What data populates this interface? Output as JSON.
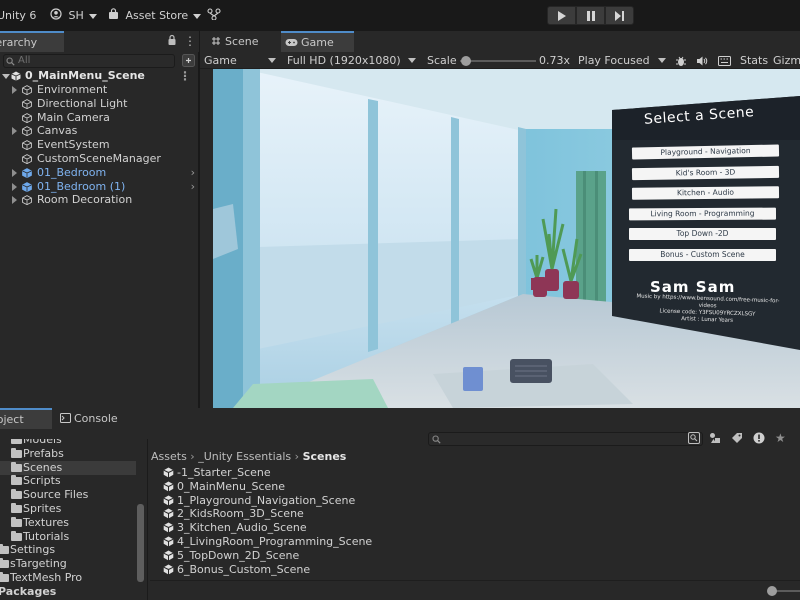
{
  "toolbar": {
    "app_name": "Unity 6",
    "account": "SH",
    "asset_store": "Asset Store",
    "play_icons": [
      "play-icon",
      "pause-icon",
      "step-icon"
    ]
  },
  "hierarchy": {
    "tab_label": "Hierarchy",
    "search_placeholder": "All",
    "scene_name": "0_MainMenu_Scene",
    "items": [
      {
        "label": "Environment",
        "kind": "object",
        "expandable": true
      },
      {
        "label": "Directional Light",
        "kind": "object",
        "expandable": false
      },
      {
        "label": "Main Camera",
        "kind": "object",
        "expandable": false
      },
      {
        "label": "Canvas",
        "kind": "object",
        "expandable": true
      },
      {
        "label": "EventSystem",
        "kind": "object",
        "expandable": false
      },
      {
        "label": "CustomSceneManager",
        "kind": "object",
        "expandable": false
      },
      {
        "label": "01_Bedroom",
        "kind": "prefab",
        "expandable": true
      },
      {
        "label": "01_Bedroom (1)",
        "kind": "prefab",
        "expandable": true
      },
      {
        "label": "Room Decoration",
        "kind": "object",
        "expandable": true
      }
    ]
  },
  "view_tabs": {
    "scene": "Scene",
    "game": "Game"
  },
  "game_controls": {
    "display": "Game",
    "resolution": "Full HD (1920x1080)",
    "scale_label": "Scale",
    "scale_value": "0.73x",
    "scale_fraction": 0.05,
    "play_mode": "Play Focused",
    "stats": "Stats",
    "gizmos": "Gizmos"
  },
  "menu": {
    "title": "Select a Scene",
    "buttons": [
      "Playground - Navigation",
      "Kid's Room - 3D",
      "Kitchen - Audio",
      "Living Room - Programming",
      "Top Down -2D",
      "Bonus - Custom Scene"
    ],
    "name": "Sam Sam",
    "credits": [
      "Music by https://www.bensound.com/free-music-for-",
      "videos",
      "License code: Y3FSU09YRCZXLSGY",
      "Artist : Lunar Years"
    ]
  },
  "project": {
    "tab_label": "Project",
    "console_label": "Console",
    "folders": [
      {
        "label": "Models",
        "selected": false,
        "indent": 1
      },
      {
        "label": "Prefabs",
        "selected": false,
        "indent": 1
      },
      {
        "label": "Scenes",
        "selected": true,
        "indent": 1
      },
      {
        "label": "Scripts",
        "selected": false,
        "indent": 1
      },
      {
        "label": "Source Files",
        "selected": false,
        "indent": 1
      },
      {
        "label": "Sprites",
        "selected": false,
        "indent": 1
      },
      {
        "label": "Textures",
        "selected": false,
        "indent": 1
      },
      {
        "label": "Tutorials",
        "selected": false,
        "indent": 1
      },
      {
        "label": "Settings",
        "selected": false,
        "indent": 0
      },
      {
        "label": "sTargeting",
        "selected": false,
        "indent": 0
      },
      {
        "label": "TextMesh Pro",
        "selected": false,
        "indent": 0
      }
    ],
    "packages_label": "Packages",
    "breadcrumb": [
      "Assets",
      "_Unity Essentials",
      "Scenes"
    ],
    "assets": [
      "-1_Starter_Scene",
      "0_MainMenu_Scene",
      "1_Playground_Navigation_Scene",
      "2_KidsRoom_3D_Scene",
      "3_Kitchen_Audio_Scene",
      "4_LivingRoom_Programming_Scene",
      "5_TopDown_2D_Scene",
      "6_Bonus_Custom_Scene"
    ]
  }
}
